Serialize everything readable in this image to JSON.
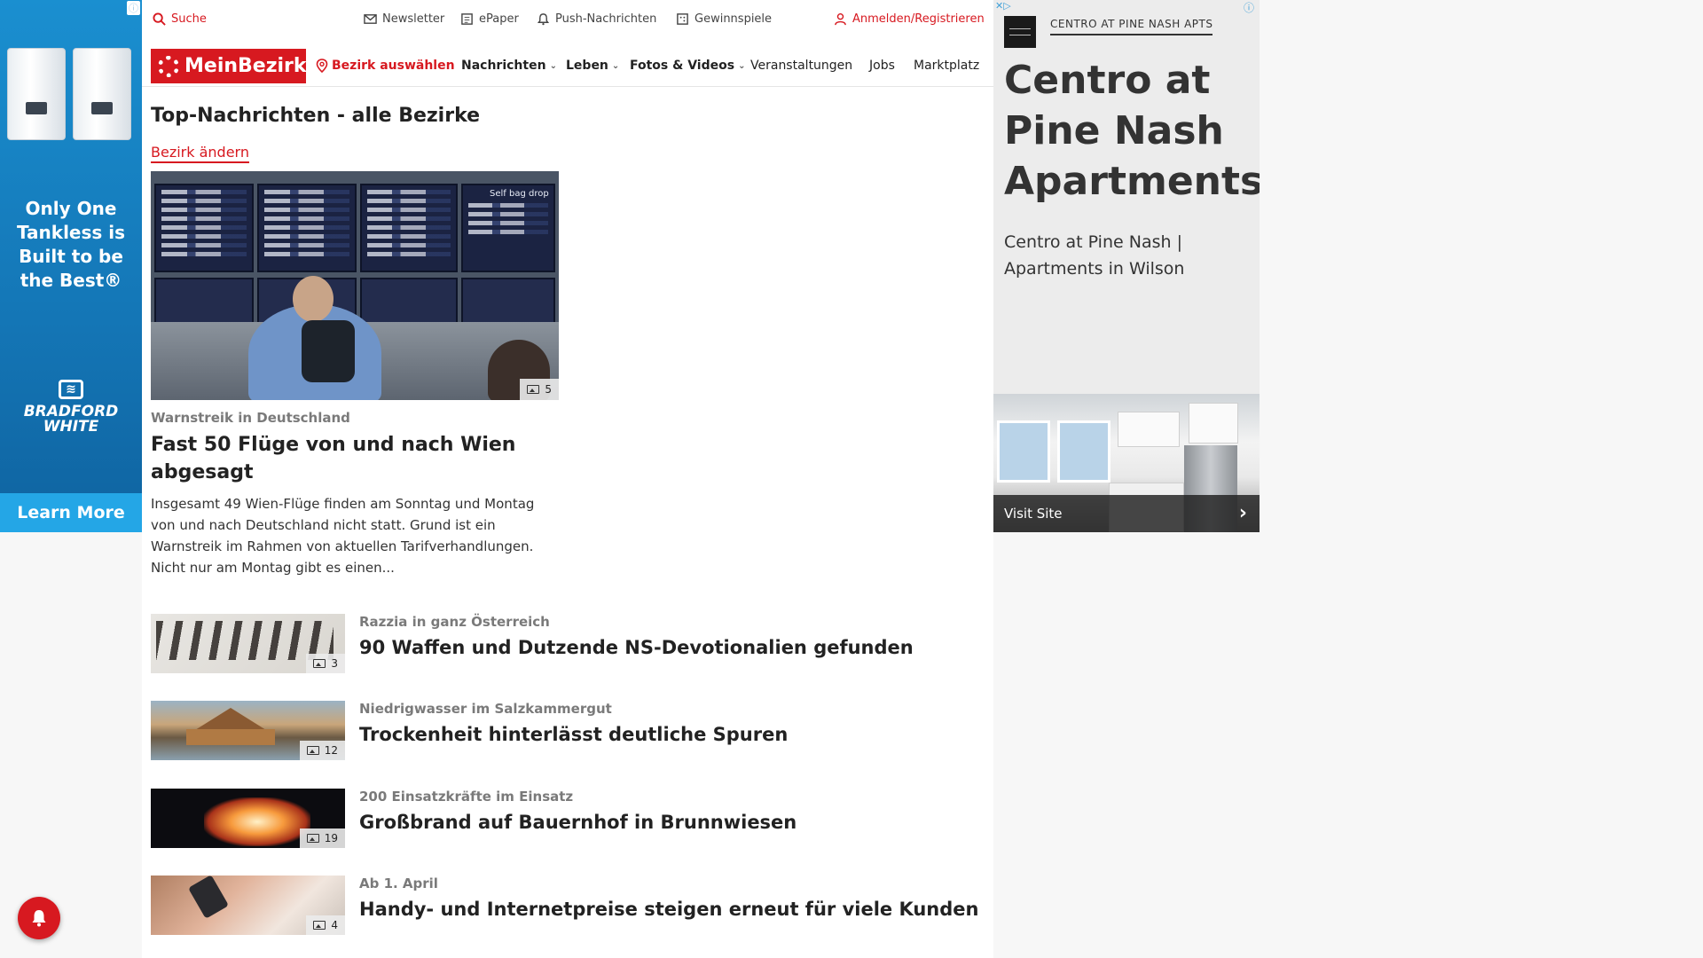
{
  "utility_bar": {
    "search": "Suche",
    "newsletter": "Newsletter",
    "epaper": "ePaper",
    "push": "Push-Nachrichten",
    "contests": "Gewinnspiele",
    "login": "Anmelden/Registrieren"
  },
  "nav": {
    "logo": "MeinBezirk",
    "district": "Bezirk auswählen",
    "items": [
      "Nachrichten",
      "Leben",
      "Fotos & Videos",
      "Veranstaltungen",
      "Jobs",
      "Marktplatz"
    ]
  },
  "page": {
    "title": "Top-Nachrichten - alle Bezirke",
    "change_link": "Bezirk ändern"
  },
  "lead_story": {
    "kicker": "Warnstreik in Deutschland",
    "headline": "Fast 50 Flüge von und nach Wien abgesagt",
    "teaser": "Insgesamt 49 Wien-Flüge finden am Sonntag und Montag von und nach Deutschland nicht statt. Grund ist ein Warnstreik im Rahmen von aktuellen Tarifverhandlungen. Nicht nur am Montag gibt es einen...",
    "photo_count": "5",
    "board_text": "Self bag drop"
  },
  "stories": [
    {
      "kicker": "Razzia in ganz Österreich",
      "headline": "90 Waffen und Dutzende NS-Devotionalien gefunden",
      "photo_count": "3"
    },
    {
      "kicker": "Niedrigwasser im Salzkammergut",
      "headline": "Trockenheit hinterlässt deutliche Spuren",
      "photo_count": "12"
    },
    {
      "kicker": "200 Einsatzkräfte im Einsatz",
      "headline": "Großbrand auf Bauernhof in Brunnwiesen",
      "photo_count": "19"
    },
    {
      "kicker": "Ab 1. April",
      "headline": "Handy- und Internetpreise steigen erneut für viele Kunden",
      "photo_count": "4"
    }
  ],
  "left_ad": {
    "headline": "Only One Tankless is Built to be the Best®",
    "brand_line1": "BRADFORD",
    "brand_line2": "WHITE",
    "cta": "Learn More"
  },
  "right_ad": {
    "advertiser": "CENTRO AT PINE NASH APTS",
    "title": "Centro at Pine Nash Apartments",
    "description": "Centro at Pine Nash | Apartments in Wilson",
    "cta": "Visit Site"
  },
  "colors": {
    "brand_red": "#d71920",
    "ad_blue": "#1a8fd0",
    "cta_blue": "#24a6e6"
  },
  "icons": [
    "search-icon",
    "mail-icon",
    "newspaper-icon",
    "bell-icon",
    "gift-icon",
    "user-icon",
    "location-pin-icon",
    "chevron-down-icon",
    "gallery-icon",
    "chevron-right-icon"
  ]
}
